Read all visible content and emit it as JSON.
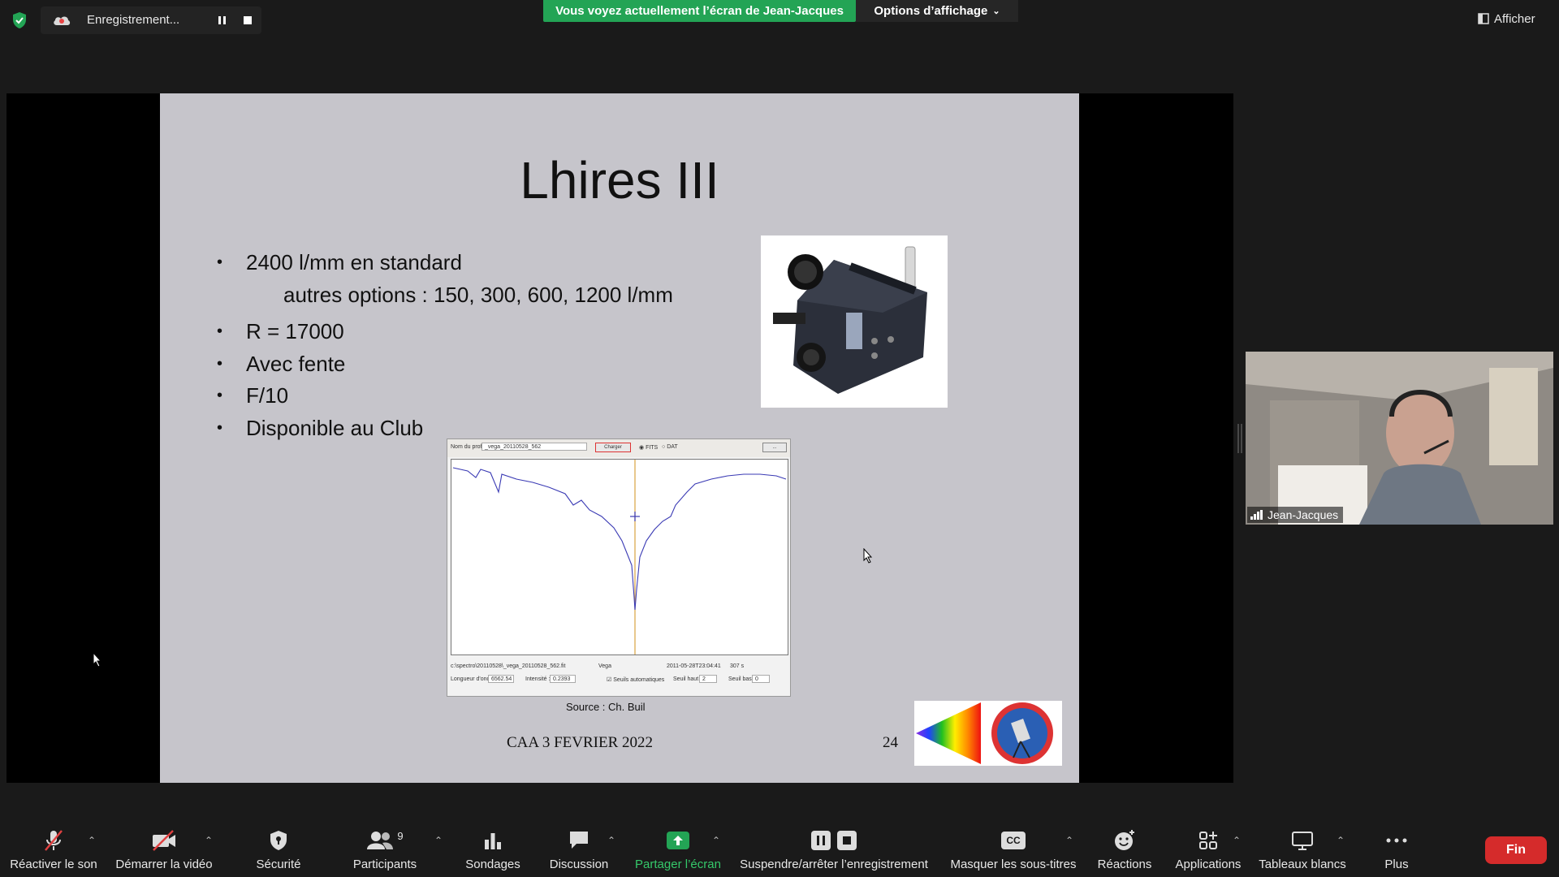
{
  "recording": {
    "label": "Enregistrement...",
    "status_color": "#e84545"
  },
  "banner": {
    "text": "Vous voyez actuellement l’écran de Jean-Jacques",
    "color": "#23a455"
  },
  "view_options": {
    "label": "Options d’affichage"
  },
  "show_button": {
    "label": "Afficher"
  },
  "slide": {
    "title": "Lhires III",
    "bullets": [
      "2400 l/mm en standard",
      "R = 17000",
      "Avec fente",
      "F/10",
      "Disponible au Club"
    ],
    "sub_bullet": "autres options : 150, 300, 600, 1200 l/mm",
    "source": "Source : Ch. Buil",
    "footer": "CAA  3 FEVRIER 2022",
    "page_number": "24",
    "spectro_window": {
      "profile_label": "Nom du profil",
      "profile_value": "_vega_20110528_562",
      "load_button": "Charger",
      "radio_fits": "FITS",
      "radio_dat": "DAT",
      "path": "c:\\spectro\\20110528\\_vega_20110528_562.fit",
      "object": "Vega",
      "date": "2011-05-28T23:04:41",
      "exposure": "307 s",
      "wavelength_label": "Longueur d'onde :",
      "wavelength_value": "6562.54",
      "intensity_label": "Intensité :",
      "intensity_value": "0.2393",
      "auto_threshold": "Seuils automatiques",
      "high_threshold_label": "Seuil haut :",
      "high_threshold_value": "2",
      "low_threshold_label": "Seuil bas :",
      "low_threshold_value": "0"
    }
  },
  "participant": {
    "name": "Jean-Jacques"
  },
  "toolbar": {
    "unmute": "Réactiver le son",
    "start_video": "Démarrer la vidéo",
    "security": "Sécurité",
    "participants": "Participants",
    "participants_count": "9",
    "polls": "Sondages",
    "chat": "Discussion",
    "share_screen": "Partager l’écran",
    "pause_stop_recording": "Suspendre/arrêter l’enregistrement",
    "hide_captions": "Masquer les sous-titres",
    "cc": "CC",
    "reactions": "Réactions",
    "apps": "Applications",
    "whiteboards": "Tableaux blancs",
    "more": "Plus",
    "end": "Fin",
    "share_color": "#23a455",
    "end_color": "#d52b2b"
  }
}
